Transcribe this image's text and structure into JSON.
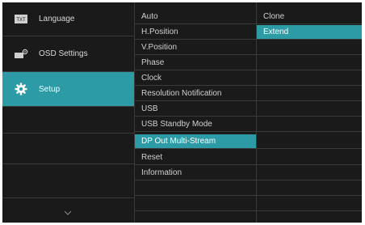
{
  "colors": {
    "background": "#1a1a1a",
    "selected": "#2c9ba6",
    "divider": "#3a3a3a",
    "text": "#d0d0d0"
  },
  "left_menu": [
    {
      "label": "Language",
      "icon": "language-txt-icon"
    },
    {
      "label": "OSD Settings",
      "icon": "osd-settings-icon"
    },
    {
      "label": "Setup",
      "icon": "gear-icon",
      "selected": true
    }
  ],
  "middle_menu": [
    {
      "label": "Auto"
    },
    {
      "label": "H.Position"
    },
    {
      "label": "V.Position"
    },
    {
      "label": "Phase"
    },
    {
      "label": "Clock"
    },
    {
      "label": "Resolution Notification"
    },
    {
      "label": "USB"
    },
    {
      "label": "USB Standby Mode"
    },
    {
      "label": "DP Out Multi-Stream",
      "selected": true
    },
    {
      "label": "Reset"
    },
    {
      "label": "Information"
    }
  ],
  "right_menu": [
    {
      "label": "Clone"
    },
    {
      "label": "Extend",
      "selected": true
    }
  ],
  "scroll_indicator": "chevron-down-icon"
}
